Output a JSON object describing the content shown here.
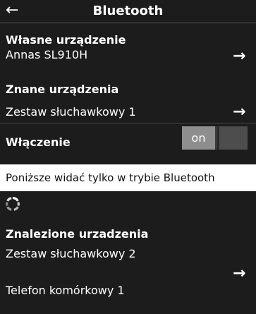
{
  "header": {
    "back_glyph": "←",
    "title": "Bluetooth"
  },
  "own_device": {
    "label": "Własne urządzenie",
    "value": "Annas SL910H",
    "arrow_glyph": "→"
  },
  "known_devices": {
    "label": "Znane urządzenia",
    "items": [
      "Zestaw słuchawkowy 1"
    ],
    "arrow_glyph": "→"
  },
  "activation": {
    "label": "Włączenie",
    "toggle_label": "on",
    "state": true
  },
  "info": {
    "text": "Poniższe widać tylko w trybie Bluetooth"
  },
  "search": {
    "icon": "searching-spinner-icon"
  },
  "found_devices": {
    "label": "Znalezione urzadzenia",
    "items": [
      "Zestaw słuchawkowy 2",
      "Telefon komórkowy 1"
    ],
    "arrow_glyph": "→"
  },
  "colors": {
    "background": "#1c1c1c",
    "text": "#ffffff",
    "toggle_on": "#8e8e8e",
    "info_bar": "#ffffff"
  }
}
